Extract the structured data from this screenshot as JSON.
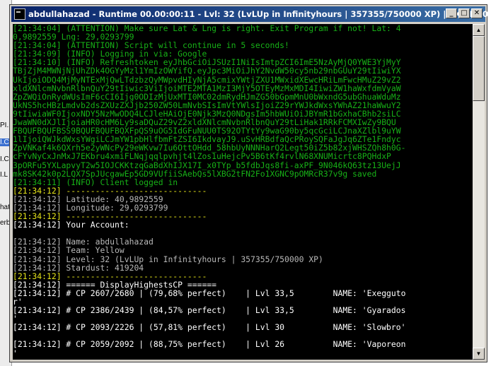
{
  "background": {
    "labels": [
      "PI.",
      "I.C",
      "I.C",
      "I.L",
      "hat",
      "erb"
    ]
  },
  "window": {
    "title": "abdullahazad - Runtime 00.00:00:11 - Lvl: 32 (LvLUp in Infinityhours | 357355/750000 XP) | EXP/H: 0 |",
    "minimize_symbol": "_",
    "maximize_symbol": "□",
    "close_symbol": "✕",
    "scroll_up_symbol": "▲",
    "scroll_down_symbol": "▼"
  },
  "colors": {
    "attention": "#17b117",
    "timestamp_highlight": "#e5e51a",
    "info": "#b8b8b8",
    "pokemon": "#ffffff",
    "console_bg": "#000000"
  },
  "console": {
    "lines": [
      {
        "color": "green",
        "text": "[21:34:04] (ATTENTION) Make sure Lat & Lng is right. Exit Program if not! Lat: 4"
      },
      {
        "color": "green",
        "text": "0,9892559 Lng: 29,0293799"
      },
      {
        "color": "green",
        "text": "[21:34:04] (ATTENTION) Script will continue in 5 seconds!"
      },
      {
        "color": "green",
        "text": "[21:34:09] (INFO) Logging in via: Google"
      },
      {
        "color": "green",
        "text": "[21:34:10] (INFO) Refreshtoken eyJhbGciOiJSUzI1NiIsImtpZCI6ImE5NzAyMjQ0YWE3YjMyY"
      },
      {
        "color": "green",
        "text": "TBjZjM4MWNjNjUhZDk4OGYyMzl1YmIzOWYifQ.eyJpc3MiOiJhY2NvdW50cy5nb29nbGUuY29tIiwiYX"
      },
      {
        "color": "green",
        "text": "UkIjoiODQ4MjMyNTExMjQwLTdzbzQyMWpvdHIyNjA5cmixYWtjZXU1MWxidXEwcHRiLmFwcHMuZ29vZ2"
      },
      {
        "color": "green",
        "text": "xldXNlcmNvbnRlbnQuY29tIiwic3ViIjoiMTE2MTA1MzI3MjY5OTEyMzMxMDI4IiwiZW1haWxfdmVyaW"
      },
      {
        "color": "green",
        "text": "ZpZWQiOnRydWUsImF6cCI6Ijg0ODIzMjUxMTI0MC02dmRydHJmZG50bGpmMnU0bWxndG5ubGhuaWduMz"
      },
      {
        "color": "green",
        "text": "UkNS5hcHBzLmdvb2dsZXUzZXJjb250ZW50LmNvbSIsImVtYWlsIjoiZ29rYWJkdWxsYWhAZ21haWwuY2"
      },
      {
        "color": "green",
        "text": "9tIiwiaWF0IjoxNDY5NzMwODQ4LCJleHAiOjE0Njk3MzQ0NDgsIm5hbWUiOiJBYmR1bGxhaCBhb2siLC"
      },
      {
        "color": "green",
        "text": "JwaWN0dXJlIjoiaHR0cHM6Ly9saDQuZ29vZ2xldXNlcmNvbnRlbnQuY29tLiHak1RRkFCMXIwZy9BQU"
      },
      {
        "color": "green",
        "text": "FBQUFBQUFBSS9BQUFBQUFBQXFpQS9uOG5IdGFuNUU0TS92OTYtYy9waG90by5qcGciLCJnaXZlbl9uYW"
      },
      {
        "color": "green",
        "text": "1lIjoiQWJkdWxsYWgiLCJmYW1pbHlfbmFtZSI6IkdvayJ9.uSvHRBdfaQcPRoySQFaJgJq6ZTe1Fndyc"
      },
      {
        "color": "green",
        "text": "ZpVNKaf4k6QXrh5e2yWNcPy29eWKvw7Iu6OttOHdd_58hbUyNNNHarQ2Legt50iZ5b82xjWHSZQh8h0G-"
      },
      {
        "color": "green",
        "text": "cFYvNyCxJnMxJ7EKbru4xmiFLNqjqqlpvhjt4lZos1uHejcPv5B6tKf4rvlN68XNUMicrtc8PQHdxP"
      },
      {
        "color": "green",
        "text": "3pORFu5YXLapvyT2w5IOJCKKtzqGaBdXhIJX17I_x0TYp_b5fdbJqs8fi-axPF_9N046kQ63tz13UejJ"
      },
      {
        "color": "green",
        "text": "mk8SK42k0p2LQX7SpJUcgawEp5GD9VUfiiSAebQs5lXBG2tFN2Fo1XGNC9pOMRcR37v9g saved"
      },
      {
        "color": "green",
        "text": "[21:34:11] (INFO) Client logged in"
      },
      {
        "color": "yellow",
        "text": "[21:34:12] -----------------------------"
      },
      {
        "color": "gray",
        "text": "[21:34:12] Latitude: 40,9892559"
      },
      {
        "color": "gray",
        "text": "[21:34:12] Longitude: 29,0293799"
      },
      {
        "color": "yellow",
        "text": "[21:34:12] -----------------------------"
      },
      {
        "color": "white",
        "text": "[21:34:12] Your Account:"
      },
      {
        "color": "gray",
        "text": ""
      },
      {
        "color": "gray",
        "text": "[21:34:12] Name: abdullahazad"
      },
      {
        "color": "gray",
        "text": "[21:34:12] Team: Yellow"
      },
      {
        "color": "gray",
        "text": "[21:34:12] Level: 32 (LvLUp in Infinityhours | 357355/750000 XP)"
      },
      {
        "color": "gray",
        "text": "[21:34:12] Stardust: 419204"
      },
      {
        "color": "yellow",
        "text": "[21:34:12] -----------------------------"
      },
      {
        "color": "white",
        "text": "[21:34:12] ====== DisplayHighestsCP ======"
      },
      {
        "color": "white",
        "text": "[21:34:12] # CP 2607/2680 | (79,68% perfect)    | Lvl 33,5        NAME: 'Exegguto"
      },
      {
        "color": "white",
        "text": "r'"
      },
      {
        "color": "white",
        "text": "[21:34:12] # CP 2386/2439 | (84,57% perfect)    | Lvl 33,5        NAME: 'Gyarados"
      },
      {
        "color": "white",
        "text": "'"
      },
      {
        "color": "white",
        "text": "[21:34:12] # CP 2093/2226 | (57,81% perfect)    | Lvl 30          NAME: 'Slowbro'"
      },
      {
        "color": "white",
        "text": ""
      },
      {
        "color": "white",
        "text": "[21:34:12] # CP 2059/2092 | (88,75% perfect)    | Lvl 26          NAME: 'Vaporeon"
      },
      {
        "color": "white",
        "text": "'"
      }
    ]
  }
}
